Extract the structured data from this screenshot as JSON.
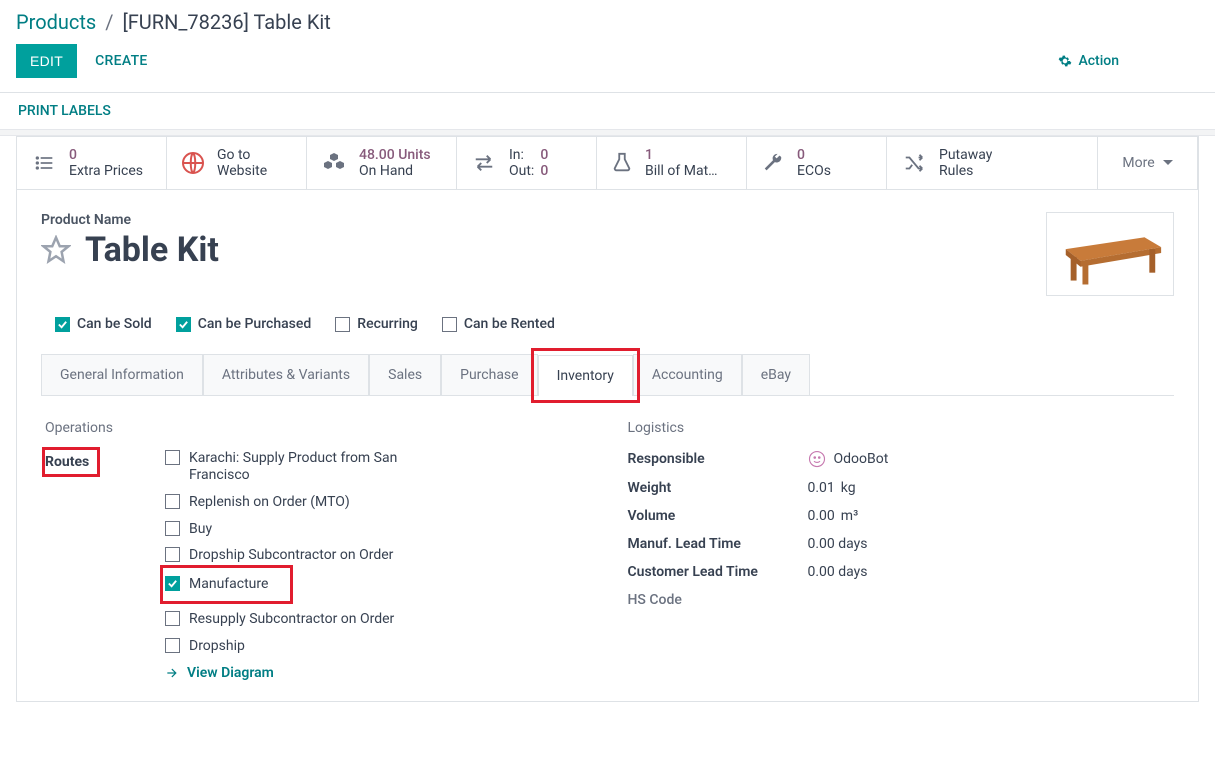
{
  "breadcrumb": {
    "root": "Products",
    "current": "[FURN_78236] Table Kit"
  },
  "toolbar": {
    "edit": "EDIT",
    "create": "CREATE",
    "action": "Action"
  },
  "printbar": {
    "label": "PRINT LABELS"
  },
  "stats": {
    "extra_prices": {
      "value": "0",
      "label": "Extra Prices"
    },
    "website": {
      "line1": "Go to",
      "line2": "Website"
    },
    "onhand": {
      "value": "48.00 Units",
      "label": "On Hand"
    },
    "moves": {
      "in_lbl": "In:",
      "in_val": "0",
      "out_lbl": "Out:",
      "out_val": "0"
    },
    "bom": {
      "value": "1",
      "label": "Bill of Mat…"
    },
    "ecos": {
      "value": "0",
      "label": "ECOs"
    },
    "putaway": {
      "line1": "Putaway",
      "line2": "Rules"
    },
    "more": "More"
  },
  "product": {
    "name_label": "Product Name",
    "name": "Table Kit"
  },
  "checks": {
    "sold": "Can be Sold",
    "purchased": "Can be Purchased",
    "recurring": "Recurring",
    "rented": "Can be Rented"
  },
  "tabs": {
    "general": "General Information",
    "attrs": "Attributes & Variants",
    "sales": "Sales",
    "purchase": "Purchase",
    "inventory": "Inventory",
    "accounting": "Accounting",
    "ebay": "eBay"
  },
  "operations": {
    "title": "Operations",
    "routes_label": "Routes",
    "routes": {
      "karachi": "Karachi: Supply Product from San Francisco",
      "mto": "Replenish on Order (MTO)",
      "buy": "Buy",
      "dropship_sub": "Dropship Subcontractor on Order",
      "manufacture": "Manufacture",
      "resupply": "Resupply Subcontractor on Order",
      "dropship": "Dropship"
    },
    "view_diagram": "View Diagram"
  },
  "logistics": {
    "title": "Logistics",
    "responsible_lbl": "Responsible",
    "responsible_val": "OdooBot",
    "weight_lbl": "Weight",
    "weight_val": "0.01",
    "weight_unit": "kg",
    "volume_lbl": "Volume",
    "volume_val": "0.00",
    "volume_unit": "m³",
    "mlt_lbl": "Manuf. Lead Time",
    "mlt_val": "0.00 days",
    "clt_lbl": "Customer Lead Time",
    "clt_val": "0.00 days",
    "hs_lbl": "HS Code"
  }
}
